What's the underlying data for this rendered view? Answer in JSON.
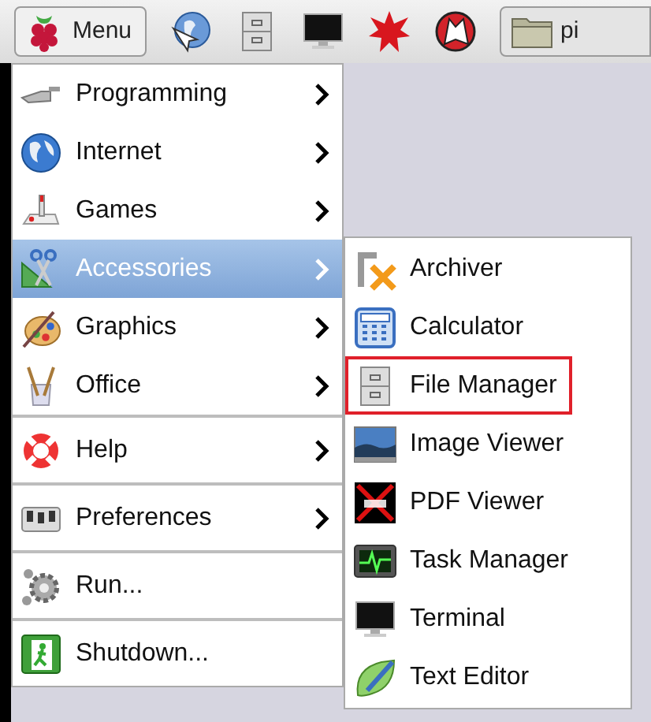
{
  "taskbar": {
    "menu_button": "Menu",
    "window_button": "pi"
  },
  "menu": {
    "sections": [
      {
        "items": [
          {
            "label": "Programming",
            "has_submenu": true,
            "selected": false
          },
          {
            "label": "Internet",
            "has_submenu": true,
            "selected": false
          },
          {
            "label": "Games",
            "has_submenu": true,
            "selected": false
          },
          {
            "label": "Accessories",
            "has_submenu": true,
            "selected": true
          },
          {
            "label": "Graphics",
            "has_submenu": true,
            "selected": false
          },
          {
            "label": "Office",
            "has_submenu": true,
            "selected": false
          }
        ]
      },
      {
        "items": [
          {
            "label": "Help",
            "has_submenu": true,
            "selected": false
          }
        ]
      },
      {
        "items": [
          {
            "label": "Preferences",
            "has_submenu": true,
            "selected": false
          }
        ]
      },
      {
        "items": [
          {
            "label": "Run...",
            "has_submenu": false,
            "selected": false
          }
        ]
      },
      {
        "items": [
          {
            "label": "Shutdown...",
            "has_submenu": false,
            "selected": false
          }
        ]
      }
    ]
  },
  "submenu": {
    "items": [
      {
        "label": "Archiver",
        "outlined": false
      },
      {
        "label": "Calculator",
        "outlined": false
      },
      {
        "label": "File Manager",
        "outlined": true
      },
      {
        "label": "Image Viewer",
        "outlined": false
      },
      {
        "label": "PDF Viewer",
        "outlined": false
      },
      {
        "label": "Task Manager",
        "outlined": false
      },
      {
        "label": "Terminal",
        "outlined": false
      },
      {
        "label": "Text Editor",
        "outlined": false
      }
    ]
  }
}
